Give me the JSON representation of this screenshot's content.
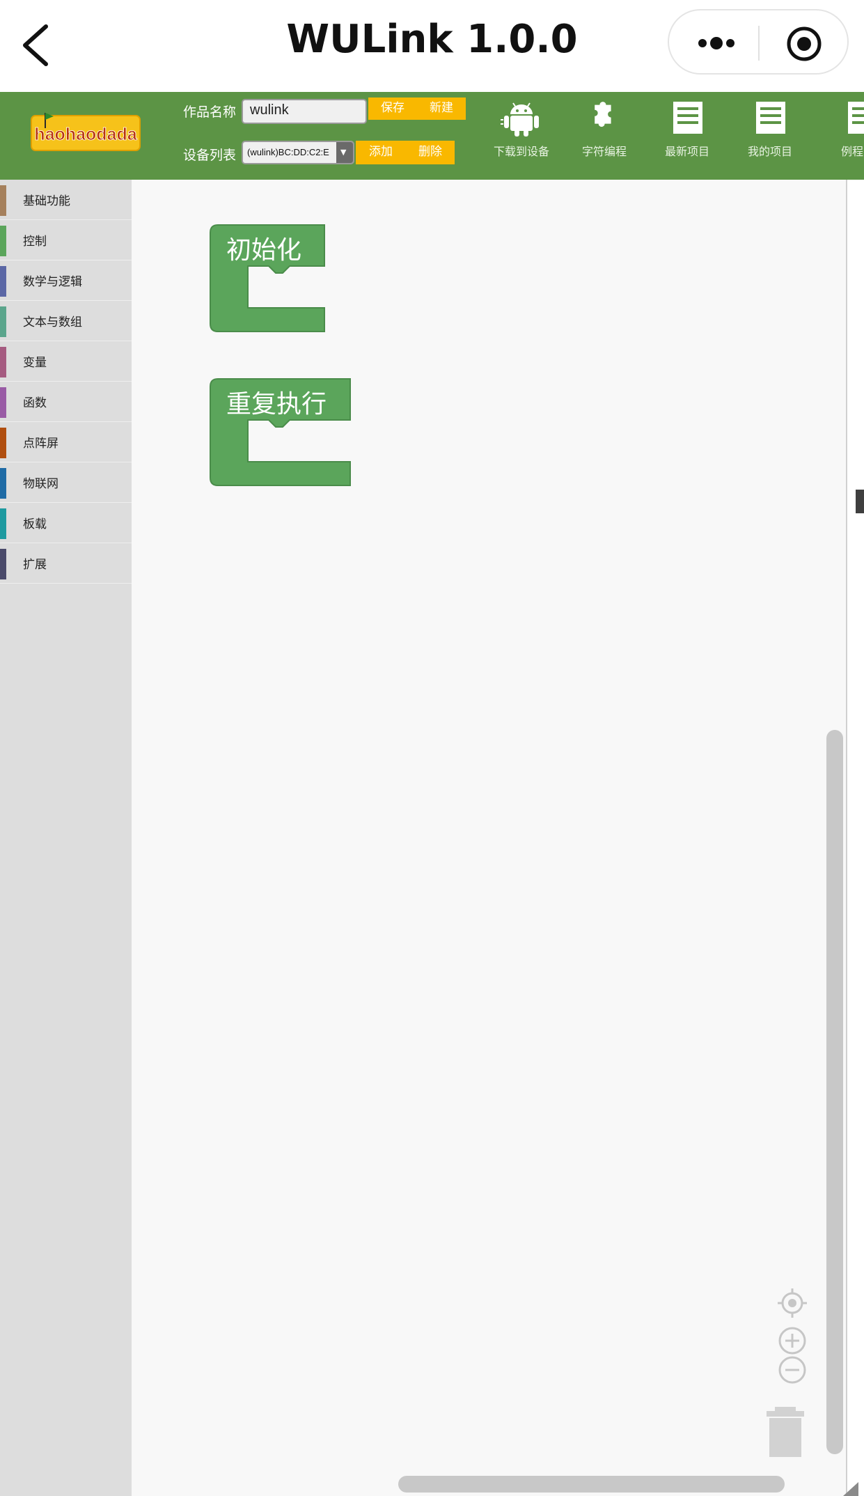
{
  "nav": {
    "title": "WULink 1.0.0",
    "back_icon": "chevron-left-icon",
    "more_icon": "more-dots-icon",
    "close_icon": "target-close-icon"
  },
  "toolbar": {
    "background": "#5c9445",
    "logo_text": "haohaodada",
    "name_label": "作品名称",
    "name_value": "wulink",
    "save_label": "保存",
    "new_label": "新建",
    "device_label": "设备列表",
    "device_value": "(wulink)BC:DD:C2:E",
    "add_label": "添加",
    "delete_label": "删除",
    "button_color": "#f9b800",
    "tools": [
      {
        "label": "下载到设备",
        "icon": "android-icon"
      },
      {
        "label": "字符编程",
        "icon": "puzzle-icon"
      },
      {
        "label": "最新项目",
        "icon": "list-icon"
      },
      {
        "label": "我的项目",
        "icon": "list-icon"
      },
      {
        "label": "例程",
        "icon": "list-icon"
      }
    ]
  },
  "categories": [
    {
      "label": "基础功能",
      "color": "#a5805c"
    },
    {
      "label": "控制",
      "color": "#5ba55b"
    },
    {
      "label": "数学与逻辑",
      "color": "#5b67a5"
    },
    {
      "label": "文本与数组",
      "color": "#5ba58c"
    },
    {
      "label": "变量",
      "color": "#a55b80"
    },
    {
      "label": "函数",
      "color": "#995ba5"
    },
    {
      "label": "点阵屏",
      "color": "#b04e0f"
    },
    {
      "label": "物联网",
      "color": "#1f6ba5"
    },
    {
      "label": "板载",
      "color": "#1e9aa0"
    },
    {
      "label": "扩展",
      "color": "#4a4a6a"
    }
  ],
  "blocks": [
    {
      "label": "初始化",
      "color": "#5ba55b"
    },
    {
      "label": "重复执行",
      "color": "#5ba55b"
    }
  ],
  "workspace_controls": [
    "center-target-icon",
    "zoom-in-icon",
    "zoom-out-icon",
    "trash-icon"
  ]
}
